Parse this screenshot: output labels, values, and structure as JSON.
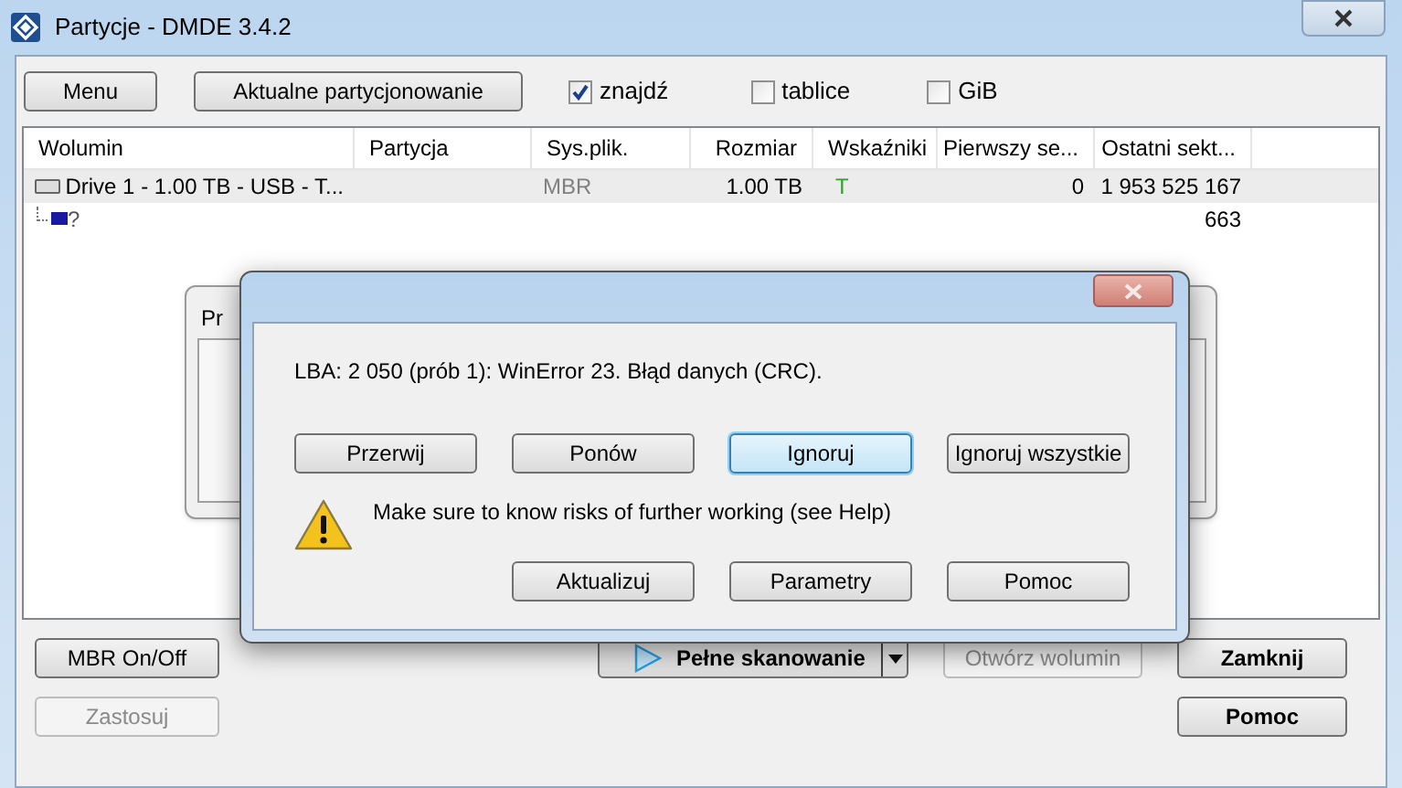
{
  "window": {
    "title": "Partycje - DMDE 3.4.2"
  },
  "toolbar": {
    "buttons": [
      {
        "label": "Menu"
      },
      {
        "label": "Aktualne partycjonowanie"
      }
    ],
    "checkboxes": [
      {
        "label": "znajdź",
        "checked": true
      },
      {
        "label": "tablice",
        "checked": false
      },
      {
        "label": "GiB",
        "checked": false
      }
    ]
  },
  "table": {
    "columns": [
      "Wolumin",
      "Partycja",
      "Sys.plik.",
      "Rozmiar",
      "Wskaźniki",
      "Pierwszy se...",
      "Ostatni sekt..."
    ],
    "rows": [
      {
        "kind": "drive",
        "selected": true,
        "cells": [
          "Drive 1 - 1.00 TB - USB - T...",
          "",
          "MBR",
          "1.00 TB",
          "T",
          "0",
          "1 953 525 167"
        ]
      },
      {
        "kind": "unknown",
        "selected": false,
        "cells": [
          "?",
          "",
          "",
          "",
          "",
          "",
          "663"
        ]
      }
    ]
  },
  "background_dialog": {
    "title": "Pr"
  },
  "error_dialog": {
    "message": "LBA: 2 050 (prób 1): WinError 23. Błąd danych (CRC).",
    "buttons": [
      {
        "label": "Przerwij",
        "default": false
      },
      {
        "label": "Ponów",
        "default": false
      },
      {
        "label": "Ignoruj",
        "default": true
      },
      {
        "label": "Ignoruj wszystkie",
        "default": false
      }
    ],
    "warning": "Make sure to know risks of further working (see Help)",
    "bottom_buttons": [
      {
        "label": "Aktualizuj"
      },
      {
        "label": "Parametry"
      },
      {
        "label": "Pomoc"
      }
    ]
  },
  "footer": {
    "left_buttons": [
      {
        "label": "MBR On/Off",
        "disabled": false
      },
      {
        "label": "Zastosuj",
        "disabled": true
      }
    ],
    "scan_button": {
      "label": "Pełne skanowanie"
    },
    "open_button": {
      "label": "Otwórz wolumin",
      "disabled": true
    },
    "right_buttons": [
      {
        "label": "Zamknij"
      },
      {
        "label": "Pomoc"
      }
    ]
  }
}
